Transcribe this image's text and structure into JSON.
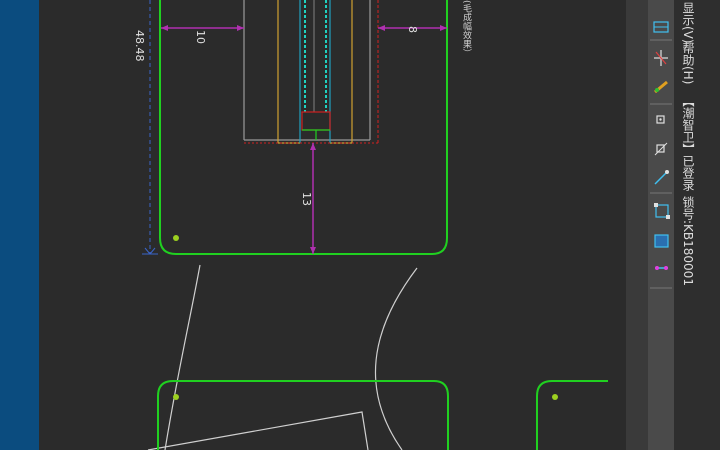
{
  "colors": {
    "canvas": "#2b2b2b",
    "left_bar": "#0b4c7f",
    "piece_outline": "#20d020",
    "dimension": "#b030b0",
    "dash_blue": "#3a64c8",
    "dash_red": "#d02020",
    "toolbar": "#4a4a4a"
  },
  "canvas": {
    "dims": {
      "left_width": "10",
      "right_width": "8",
      "bottom_height": "13",
      "vertical_ruler": "48.48"
    },
    "note": "(毛成幅效果）"
  },
  "menu": {
    "display": "显示(V)",
    "help": "帮助(H)"
  },
  "status": {
    "product": "【潮智卫】已登录",
    "lock": "锁号:KB180001"
  },
  "toolbar_icons": [
    "ruler-icon",
    "star-icon",
    "paint-icon",
    "point-icon",
    "node-icon",
    "arrow-line-icon",
    "select-rect-icon",
    "fill-rect-icon",
    "segment-icon"
  ]
}
